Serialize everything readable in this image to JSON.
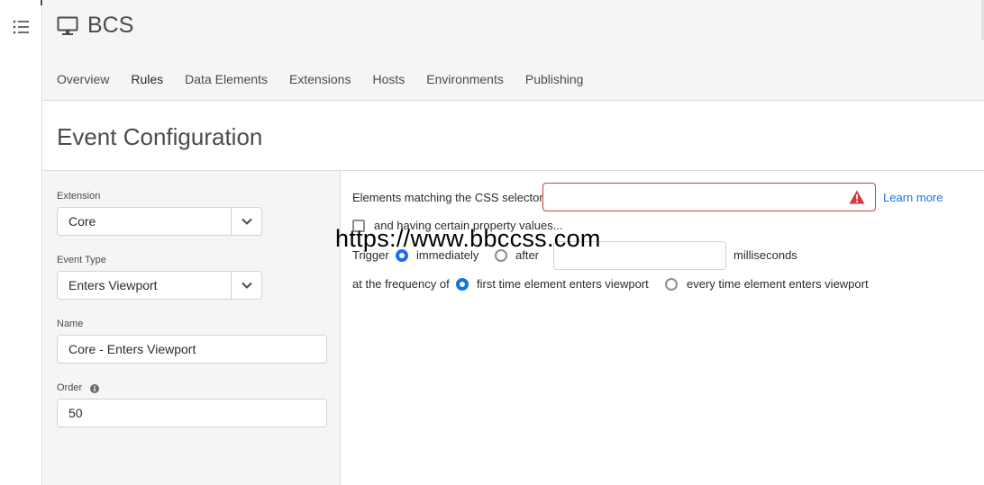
{
  "app": {
    "title": "BCS"
  },
  "tabs": [
    {
      "label": "Overview"
    },
    {
      "label": "Rules"
    },
    {
      "label": "Data Elements"
    },
    {
      "label": "Extensions"
    },
    {
      "label": "Hosts"
    },
    {
      "label": "Environments"
    },
    {
      "label": "Publishing"
    }
  ],
  "active_tab": "Rules",
  "page": {
    "title": "Event Configuration"
  },
  "form": {
    "extension": {
      "label": "Extension",
      "value": "Core"
    },
    "event_type": {
      "label": "Event Type",
      "value": "Enters Viewport"
    },
    "name": {
      "label": "Name",
      "value": "Core - Enters Viewport"
    },
    "order": {
      "label": "Order",
      "value": "50"
    }
  },
  "config": {
    "css_selector_label": "Elements matching the CSS selector",
    "css_selector_value": "",
    "learn_more": "Learn more",
    "property_values_label": "and having certain property values...",
    "property_values_checked": false,
    "trigger_label": "Trigger",
    "trigger_immediately": "immediately",
    "trigger_after": "after",
    "trigger_selected": "immediately",
    "delay_value": "",
    "milliseconds": "milliseconds",
    "frequency_label": "at the frequency of",
    "frequency_first": "first time element enters viewport",
    "frequency_every": "every time element enters viewport",
    "frequency_selected": "first"
  },
  "watermark": "https://www.bbccss.com",
  "colors": {
    "accent": "#1473e6",
    "error": "#d7373f",
    "panel": "#f5f5f5"
  },
  "icons": [
    "menu-icon",
    "monitor-icon",
    "chevron-down-icon",
    "info-icon",
    "alert-icon"
  ]
}
